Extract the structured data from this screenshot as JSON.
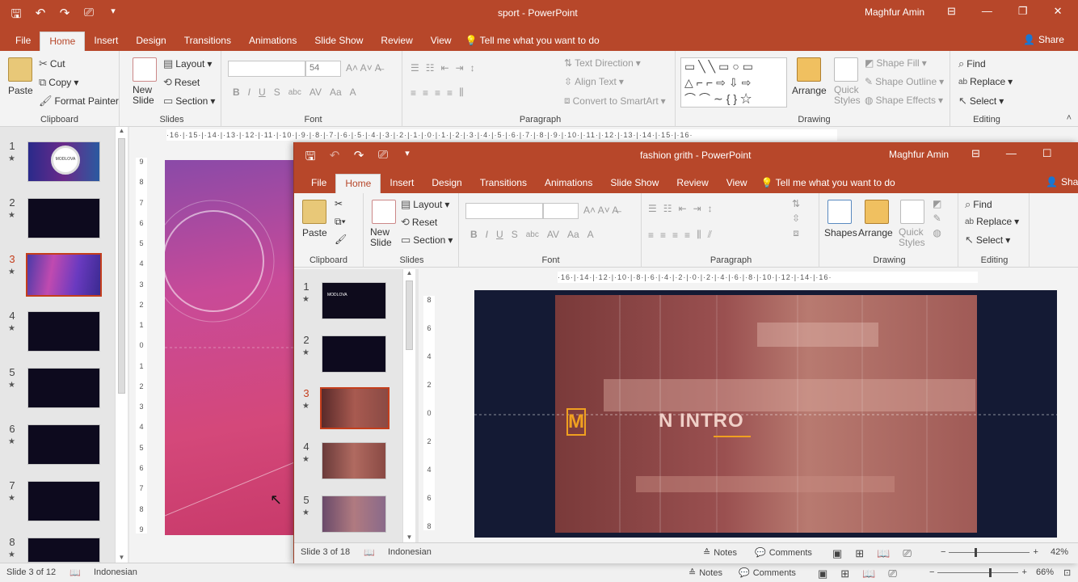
{
  "back": {
    "title": "sport  -  PowerPoint",
    "user": "Maghfur Amin",
    "share": "Share",
    "tabs": [
      "File",
      "Home",
      "Insert",
      "Design",
      "Transitions",
      "Animations",
      "Slide Show",
      "Review",
      "View"
    ],
    "tellme": "Tell me what you want to do",
    "clipboard": {
      "paste": "Paste",
      "cut": "Cut",
      "copy": "Copy",
      "format_painter": "Format Painter",
      "label": "Clipboard"
    },
    "slides": {
      "new_slide": "New Slide",
      "layout": "Layout",
      "reset": "Reset",
      "section": "Section",
      "label": "Slides"
    },
    "font": {
      "size": "54",
      "label": "Font"
    },
    "paragraph": {
      "text_direction": "Text Direction",
      "align_text": "Align Text",
      "convert_smartart": "Convert to SmartArt",
      "label": "Paragraph"
    },
    "drawing": {
      "arrange": "Arrange",
      "quick_styles": "Quick Styles",
      "shape_fill": "Shape Fill",
      "shape_outline": "Shape Outline",
      "shape_effects": "Shape Effects",
      "label": "Drawing"
    },
    "editing": {
      "find": "Find",
      "replace": "Replace",
      "select": "Select",
      "label": "Editing"
    },
    "ruler": "·16·|·15·|·14·|·13·|·12·|·11·|·10·|·9·|·8·|·7·|·6·|·5·|·4·|·3·|·2·|·1·|·0·|·1·|·2·|·3·|·4·|·5·|·6·|·7·|·8·|·9·|·10·|·11·|·12·|·13·|·14·|·15·|·16·",
    "vruler": [
      "9",
      "8",
      "7",
      "6",
      "5",
      "4",
      "3",
      "2",
      "1",
      "0",
      "1",
      "2",
      "3",
      "4",
      "5",
      "6",
      "7",
      "8",
      "9"
    ],
    "thumbs": [
      {
        "num": "1",
        "bg": "#3a1f6e"
      },
      {
        "num": "2",
        "bg": "#0d0a1e"
      },
      {
        "num": "3",
        "bg": "#6a3a8e"
      },
      {
        "num": "4",
        "bg": "#0d0a1e"
      },
      {
        "num": "5",
        "bg": "#0d0a1e"
      },
      {
        "num": "6",
        "bg": "#0d0a1e"
      },
      {
        "num": "7",
        "bg": "#0d0a1e"
      },
      {
        "num": "8",
        "bg": "#0d0a1e"
      }
    ],
    "thumb1_text": "MODLOVA",
    "status": {
      "slide": "Slide 3 of 12",
      "lang": "Indonesian",
      "notes": "Notes",
      "comments": "Comments",
      "zoom": "66%"
    }
  },
  "front": {
    "title": "fashion grith  -  PowerPoint",
    "user": "Maghfur Amin",
    "share": "Shar",
    "tabs": [
      "File",
      "Home",
      "Insert",
      "Design",
      "Transitions",
      "Animations",
      "Slide Show",
      "Review",
      "View"
    ],
    "tellme": "Tell me what you want to do",
    "clipboard": {
      "paste": "Paste",
      "label": "Clipboard"
    },
    "slides": {
      "new_slide": "New Slide",
      "layout": "Layout",
      "reset": "Reset",
      "section": "Section",
      "label": "Slides"
    },
    "font": {
      "label": "Font"
    },
    "paragraph": {
      "label": "Paragraph"
    },
    "drawing": {
      "shapes": "Shapes",
      "arrange": "Arrange",
      "quick_styles": "Quick Styles",
      "label": "Drawing"
    },
    "editing": {
      "find": "Find",
      "replace": "Replace",
      "select": "Select",
      "label": "Editing"
    },
    "ruler": "·16·|·14·|·12·|·10·|·8·|·6·|·4·|·2·|·0·|·2·|·4·|·6·|·8·|·10·|·12·|·14·|·16·",
    "vruler": [
      "8",
      "6",
      "4",
      "2",
      "0",
      "2",
      "4",
      "6",
      "8"
    ],
    "thumbs": [
      {
        "num": "1",
        "bg": "#0e0b1c"
      },
      {
        "num": "2",
        "bg": "#0d0a1e"
      },
      {
        "num": "3",
        "bg": "#7a3a34"
      },
      {
        "num": "4",
        "bg": "#8a4a44"
      },
      {
        "num": "5",
        "bg": "#8a5a6a"
      }
    ],
    "thumb1_text": "MODLOVA",
    "slide_text_m": "M",
    "slide_text_intro": "N INTRO",
    "status": {
      "slide": "Slide 3 of 18",
      "lang": "Indonesian",
      "notes": "Notes",
      "comments": "Comments",
      "zoom": "42%"
    }
  },
  "colors": {
    "accent": "#b7472a",
    "selected_thumb": "#c43e1c",
    "slide_orange": "#f0a020"
  }
}
